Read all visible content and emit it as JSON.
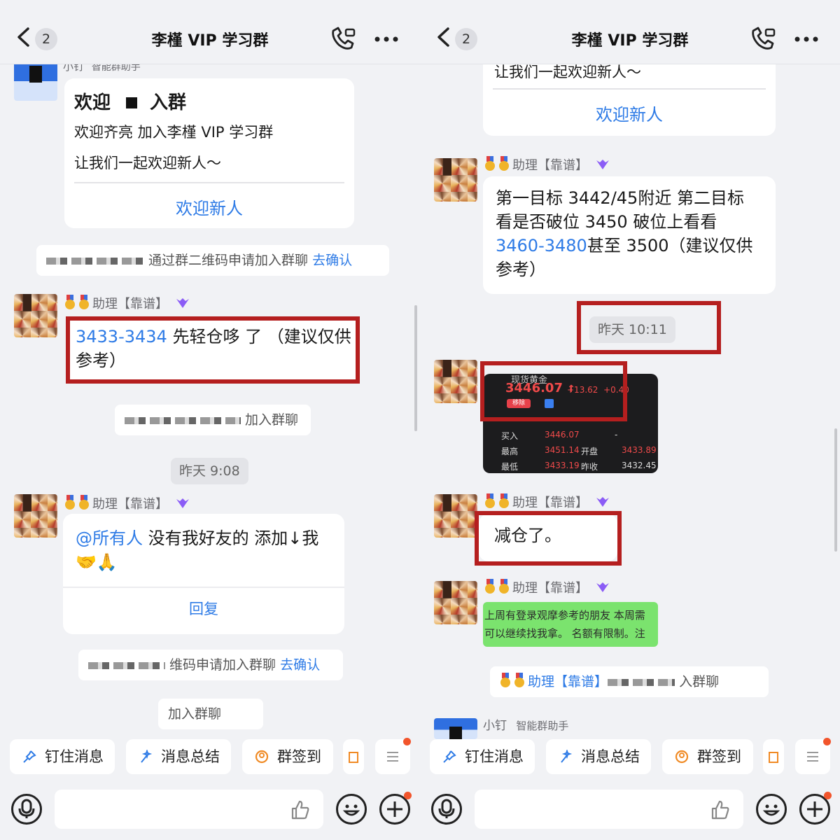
{
  "header": {
    "unread_count": "2",
    "title": "李槿 VIP 学习群"
  },
  "left": {
    "welcome_sender": "小钉",
    "welcome_sender_tag": "智能群助手",
    "welcome_title": "欢迎",
    "welcome_title_tail": "入群",
    "welcome_line1": "欢迎齐亮 加入李槿 VIP 学习群",
    "welcome_line2": "让我们一起欢迎新人～",
    "welcome_button": "欢迎新人",
    "sys1_text": "通过群二维码申请加入群聊",
    "sys1_link": "去确认",
    "assistant_name": "助理【靠谱】",
    "msg1_range": "3433-3434",
    "msg1_text": "先轻仓哆 了 （建议仅供参考）",
    "sys2_text": "加入群聊",
    "time1": "昨天 9:08",
    "msg2_mention": "@所有人",
    "msg2_text": "没有我好友的 添加↓我🤝🙏",
    "msg2_button": "回复",
    "sys3_text": "维码申请加入群聊",
    "sys3_link": "去确认",
    "sys4_text": "加入群聊"
  },
  "right": {
    "welcome_line2": "让我们一起欢迎新人～",
    "welcome_button": "欢迎新人",
    "assistant_name": "助理【靠谱】",
    "msg1_pre": "第一目标 3442/45附近 第二目标 看是否破位 3450 破位上看看",
    "msg1_range": "3460-3480",
    "msg1_post": "甚至 3500（建议仅供参考）",
    "time1": "昨天 10:11",
    "stock_title": "现货黄金",
    "stock_price": "3446.07",
    "stock_arrow": "↑",
    "stock_change": "+13.62",
    "stock_pct": "+0.40",
    "stock_tag": "移除",
    "stock_buy_label": "买入",
    "stock_buy_value": "3446.07",
    "stock_buy_dash": "-",
    "stock_high_label": "最高",
    "stock_high_value": "3451.14",
    "stock_open_label": "开盘",
    "stock_open_value": "3433.89",
    "stock_low_label": "最低",
    "stock_low_value": "3433.19",
    "stock_prev_label": "昨收",
    "stock_prev_value": "3432.45",
    "msg2_text": "减仓了。",
    "msg3_line1": "上周有登录观摩参考的朋友 本周需",
    "msg3_line2": "可以继续找我拿。 名额有限制。注",
    "sys1_name": "助理【靠谱】",
    "sys1_text": "入群聊",
    "bottom_sender": "小钉",
    "bottom_sender_tag": "智能群助手"
  },
  "toolbar": {
    "pin": "钉住消息",
    "summary": "消息总结",
    "checkin": "群签到"
  },
  "icons": [
    "back-chevron-icon",
    "call-icon",
    "more-icon",
    "pin-icon",
    "sparkle-icon",
    "checkin-icon",
    "menu-icon",
    "voice-icon",
    "thumbs-up-icon",
    "emoji-icon",
    "plus-icon"
  ],
  "colors": {
    "accent": "#2e7be6",
    "highlight_box": "#b51f1f",
    "background": "#f1f2f5",
    "notify_dot": "#f2552c"
  }
}
